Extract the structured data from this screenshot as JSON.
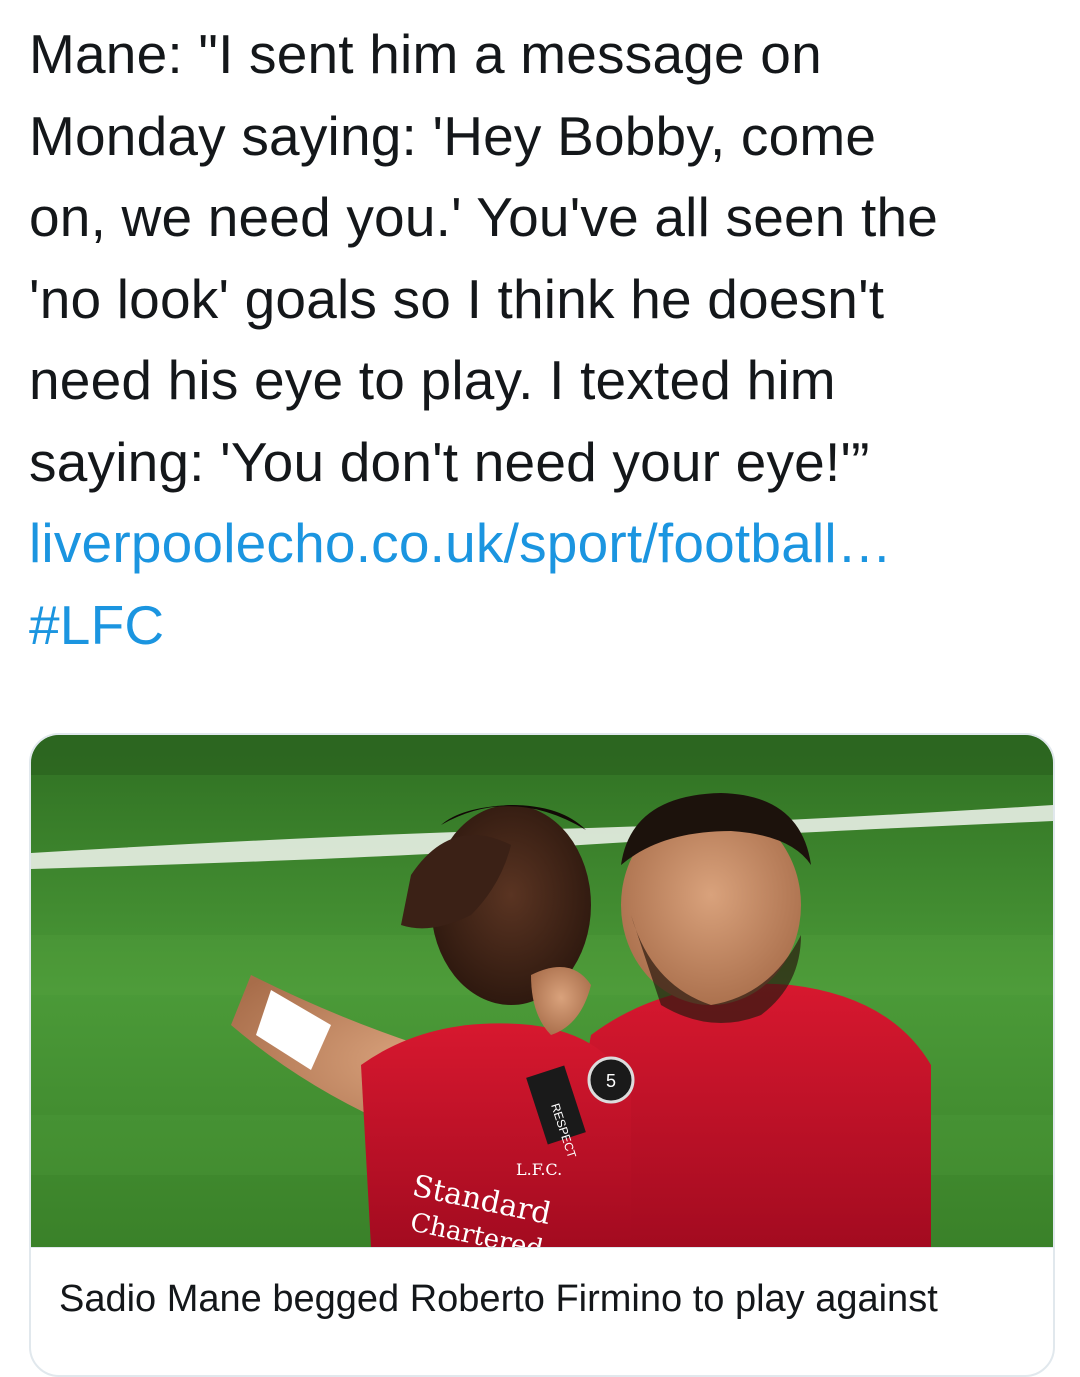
{
  "tweet": {
    "lines": [
      "Mane: \"I sent him a message on",
      "Monday saying: 'Hey Bobby, come",
      "on, we need you.' You've all seen the",
      "'no look' goals so I think he doesn't",
      "need his eye to play. I texted him",
      "saying: 'You don't need your eye!'”"
    ],
    "link_text": "liverpoolecho.co.uk/sport/football…",
    "hashtag": "#LFC"
  },
  "card": {
    "image_subject": "two Liverpool players celebrating on a football pitch, one covering his eye with his hand",
    "shirt_texts": [
      "Standard",
      "Chartered",
      "L.F.C.",
      "RESPECT"
    ],
    "caption": "Sadio Mane begged Roberto Firmino to play against"
  },
  "colors": {
    "text": "#14171a",
    "link": "#1b95e0",
    "card_border": "#e1e8ed",
    "pitch": "#3f8a2e",
    "shirt": "#c8102e"
  }
}
